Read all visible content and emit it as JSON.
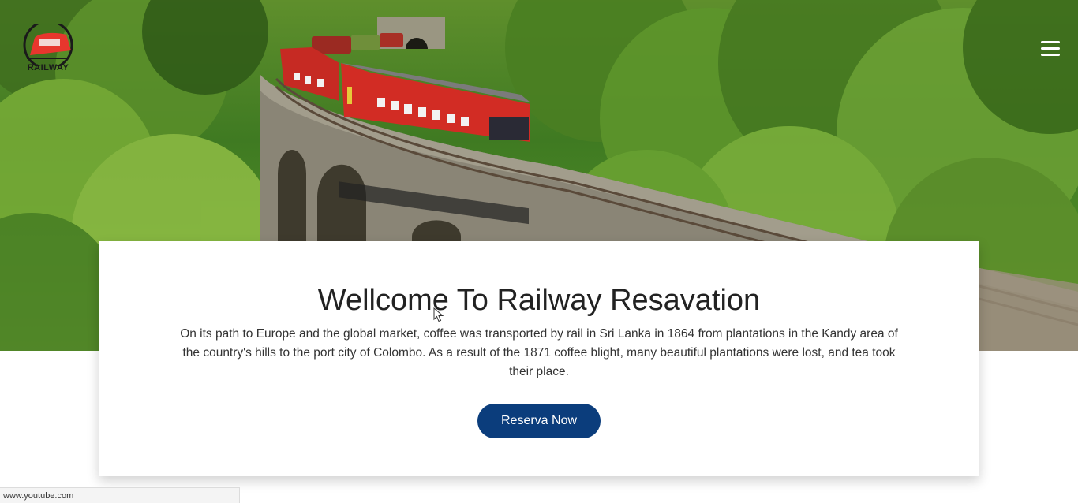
{
  "brand": {
    "logo_text": "RAILWAY",
    "logo_color": "#e8362d"
  },
  "header": {
    "menu_icon": "hamburger-menu-icon"
  },
  "hero": {
    "title": "Wellcome To Railway Resavation",
    "description": "On its path to Europe and the global market, coffee was transported by rail in Sri Lanka in 1864 from plantations in the Kandy area of the country's hills to the port city of Colombo. As a result of the 1871 coffee blight, many beautiful plantations were lost, and tea took their place.",
    "cta_label": "Reserva Now",
    "cta_color": "#0b3d7c"
  },
  "status_bar": {
    "url": "www.youtube.com"
  }
}
